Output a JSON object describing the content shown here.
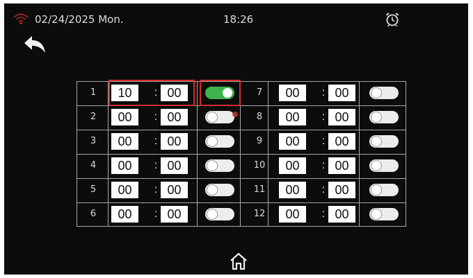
{
  "status": {
    "date": "02/24/2025 Mon.",
    "time": "18:26",
    "wifi_icon": "wifi-icon",
    "alarm_icon": "alarm-clock-icon"
  },
  "nav": {
    "back_icon": "back-arrow-icon",
    "home_icon": "home-icon"
  },
  "colors": {
    "screen_bg": "#0c0c0c",
    "toggle_on": "#3fb44d",
    "toggle_off": "#ececec",
    "highlight": "#d62a2a"
  },
  "schedule": {
    "separator": ":",
    "slots": [
      {
        "index": "1",
        "hour": "10",
        "minute": "00",
        "enabled": true
      },
      {
        "index": "2",
        "hour": "00",
        "minute": "00",
        "enabled": false
      },
      {
        "index": "3",
        "hour": "00",
        "minute": "00",
        "enabled": false
      },
      {
        "index": "4",
        "hour": "00",
        "minute": "00",
        "enabled": false
      },
      {
        "index": "5",
        "hour": "00",
        "minute": "00",
        "enabled": false
      },
      {
        "index": "6",
        "hour": "00",
        "minute": "00",
        "enabled": false
      },
      {
        "index": "7",
        "hour": "00",
        "minute": "00",
        "enabled": false
      },
      {
        "index": "8",
        "hour": "00",
        "minute": "00",
        "enabled": false
      },
      {
        "index": "9",
        "hour": "00",
        "minute": "00",
        "enabled": false
      },
      {
        "index": "10",
        "hour": "00",
        "minute": "00",
        "enabled": false
      },
      {
        "index": "11",
        "hour": "00",
        "minute": "00",
        "enabled": false
      },
      {
        "index": "12",
        "hour": "00",
        "minute": "00",
        "enabled": false
      }
    ]
  }
}
